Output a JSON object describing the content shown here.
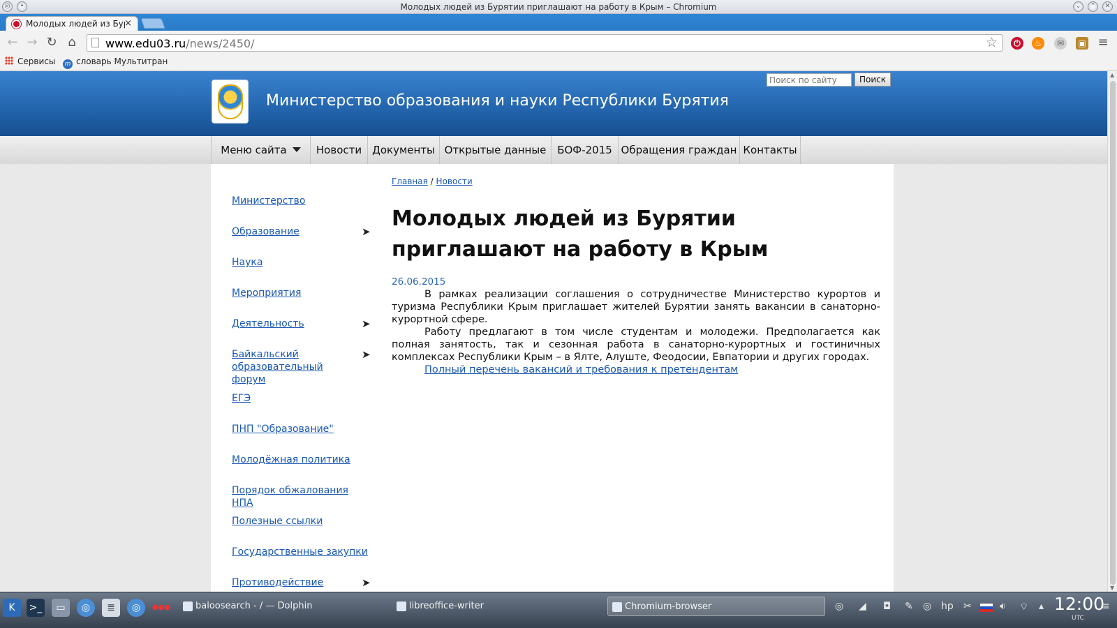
{
  "window": {
    "title": "Молодых людей из Бурятии приглашают на работу в Крым – Chromium"
  },
  "tab": {
    "title": "Молодых людей из Бурят",
    "close": "×"
  },
  "toolbar": {
    "back_icon": "arrow-left-icon",
    "forward_icon": "arrow-right-icon",
    "url_host": "www.edu03.ru",
    "url_path": "/news/2450/"
  },
  "bookmarks": [
    {
      "label": "Сервисы",
      "icon": "apps-grid-icon"
    },
    {
      "label": "словарь Мультитран",
      "icon": "multitran-icon"
    }
  ],
  "site": {
    "title": "Министерство образования и науки Республики Бурятия",
    "search_placeholder": "Поиск по сайту",
    "search_button": "Поиск"
  },
  "nav": [
    {
      "label": "Меню сайта",
      "has_caret": true
    },
    {
      "label": "Новости"
    },
    {
      "label": "Документы"
    },
    {
      "label": "Открытые данные"
    },
    {
      "label": "БОФ-2015"
    },
    {
      "label": "Обращения граждан"
    },
    {
      "label": "Контакты"
    }
  ],
  "sidebar": [
    {
      "label": "Министерство",
      "arrow": false
    },
    {
      "label": "Образование",
      "arrow": true
    },
    {
      "label": "Наука",
      "arrow": false
    },
    {
      "label": "Мероприятия",
      "arrow": false
    },
    {
      "label": "Деятельность",
      "arrow": true
    },
    {
      "label": "Байкальский образовательный форум",
      "arrow": true
    },
    {
      "label": "ЕГЭ",
      "arrow": false
    },
    {
      "label": "ПНП \"Образование\"",
      "arrow": false
    },
    {
      "label": "Молодёжная политика",
      "arrow": false
    },
    {
      "label": "Порядок обжалования НПА",
      "arrow": false
    },
    {
      "label": "Полезные ссылки",
      "arrow": false
    },
    {
      "label": "Государственные закупки",
      "arrow": false
    },
    {
      "label": "Противодействие",
      "arrow": true
    }
  ],
  "breadcrumb": {
    "home": "Главная",
    "separator": "/",
    "section": "Новости"
  },
  "article": {
    "headline": "Молодых людей из Бурятии приглашают на работу в Крым",
    "date": "26.06.2015",
    "paragraph1": "В рамках реализации соглашения о сотрудничестве Министерство курортов и туризма Республики Крым приглашает жителей Бурятии занять вакансии в санаторно-курортной сфере.",
    "paragraph2": "Работу предлагают в том числе студентам и молодежи. Предполагается как полная занятость, так и сезонная работа в санаторно-курортных и гостиничных комплексах Республики Крым – в Ялте, Алуште, Феодосии, Евпатории и других городах.",
    "link": "Полный перечень вакансий и требования к претендентам"
  },
  "taskbar": {
    "tasks": [
      {
        "label": "baloosearch - / — Dolphin"
      },
      {
        "label": "libreoffice-writer"
      },
      {
        "label": "Chromium-browser",
        "active": true
      }
    ],
    "clock": "12:00",
    "timezone": "UTC"
  }
}
